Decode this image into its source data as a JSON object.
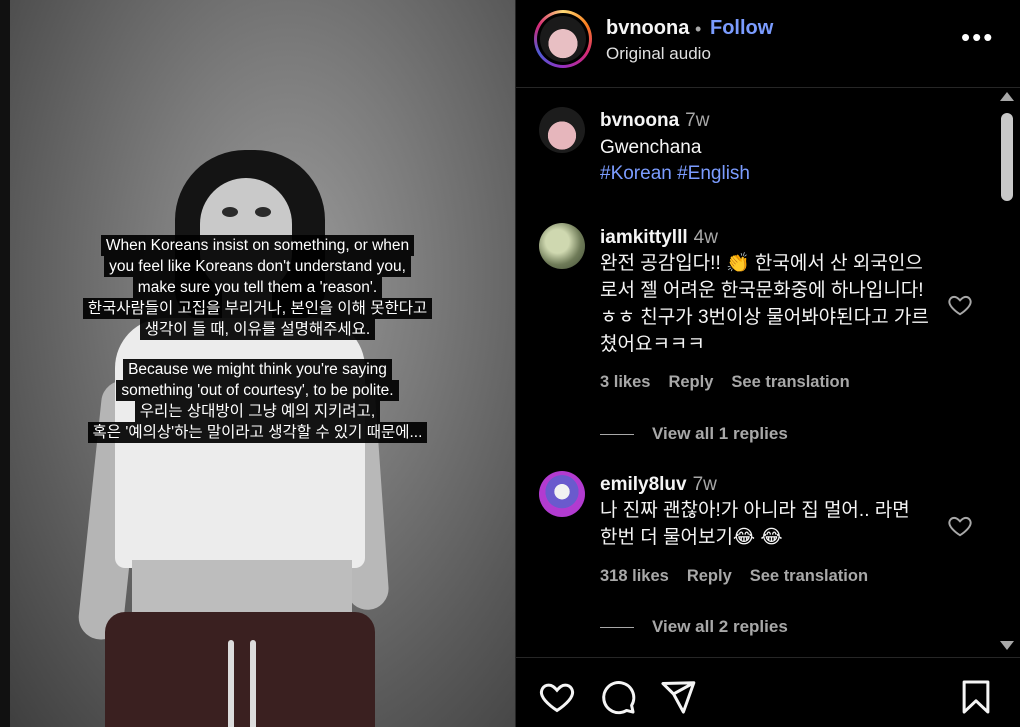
{
  "post": {
    "username": "bvnoona",
    "follow_label": "Follow",
    "audio": "Original audio",
    "more_label": "•••",
    "caption_block_1": [
      "When Koreans insist on something, or when",
      "you feel like Koreans don't understand you,",
      "make sure you tell them a 'reason'.",
      "한국사람들이 고집을 부리거나, 본인을 이해 못한다고",
      "생각이 들 때, 이유를 설명해주세요."
    ],
    "caption_block_2": [
      "Because we might think you're saying",
      "something 'out of courtesy', to be polite.",
      "우리는 상대방이 그냥 예의 지키려고,",
      "혹은 '예의상'하는 말이라고 생각할 수 있기 때문에..."
    ]
  },
  "comments": [
    {
      "username": "bvnoona",
      "time": "7w",
      "text": "Gwenchana",
      "tags": "#Korean #English"
    },
    {
      "username": "iamkittylll",
      "time": "4w",
      "text": "완전 공감입다!! 👏 한국에서 산 외국인으로서 젤 어려운 한국문화중에 하나입니다! ㅎㅎ 친구가 3번이상 물어봐야된다고 가르쳤어요ㅋㅋㅋ",
      "likes": "3 likes",
      "reply": "Reply",
      "translate": "See translation",
      "replies": "View all 1 replies"
    },
    {
      "username": "emily8luv",
      "time": "7w",
      "text": "나 진짜 괜찮아!가 아니라 집 멀어.. 라면 한번 더 물어보기😂 😂",
      "likes": "318 likes",
      "reply": "Reply",
      "translate": "See translation",
      "replies": "View all 2 replies"
    }
  ],
  "icons": {
    "like": "heart-icon",
    "comment": "comment-icon",
    "share": "paper-plane-icon",
    "save": "bookmark-icon"
  },
  "colors": {
    "follow": "#7b9cff",
    "hashtag": "#7b9cff",
    "muted": "#a8a8a8",
    "background": "#000000"
  }
}
